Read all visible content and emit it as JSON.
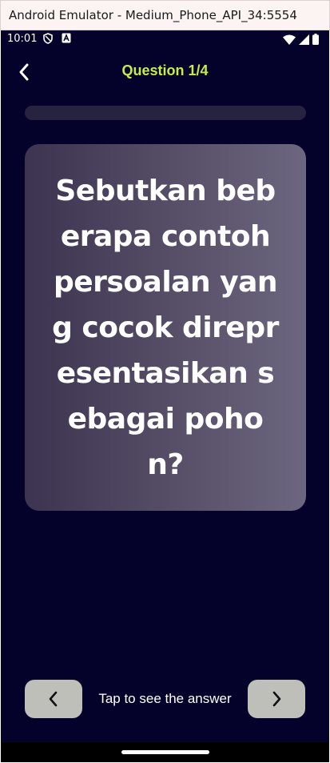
{
  "window": {
    "title": "Android Emulator - Medium_Phone_API_34:5554"
  },
  "status_bar": {
    "time": "10:01",
    "left_icons": [
      "shield-icon",
      "accessibility-a-icon"
    ],
    "right_icons": [
      "wifi-icon",
      "cell-signal-icon",
      "battery-icon"
    ]
  },
  "header": {
    "title": "Question 1/4",
    "back_icon": "chevron-left-icon"
  },
  "progress": {
    "current": 1,
    "total": 4,
    "filled_fraction": 0
  },
  "card": {
    "question": "Sebutkan beberapa contoh persoalan yang cocok direpresentasikan sebagai pohon?"
  },
  "footer": {
    "hint": "Tap to see the answer",
    "prev_icon": "chevron-left-icon",
    "next_icon": "chevron-right-icon"
  },
  "colors": {
    "background": "#04022a",
    "accent": "#c6ec4a",
    "progress_track": "#25233f",
    "card_start": "#3c3450",
    "card_end": "#6d6680",
    "nav_button": "#bebfb9"
  }
}
